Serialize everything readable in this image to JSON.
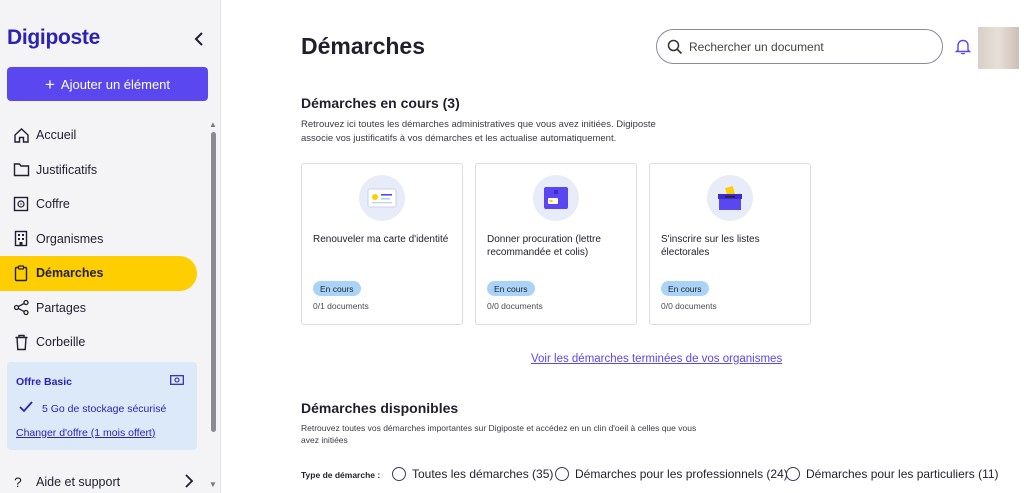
{
  "app": {
    "logo": "Digiposte",
    "add_button": "Ajouter un élément"
  },
  "sidebar": {
    "items": [
      {
        "label": "Accueil",
        "icon": "home-icon"
      },
      {
        "label": "Justificatifs",
        "icon": "folder-icon"
      },
      {
        "label": "Coffre",
        "icon": "safe-icon"
      },
      {
        "label": "Organismes",
        "icon": "building-icon"
      },
      {
        "label": "Démarches",
        "icon": "clipboard-icon",
        "active": true
      },
      {
        "label": "Partages",
        "icon": "share-icon"
      },
      {
        "label": "Corbeille",
        "icon": "trash-icon"
      }
    ],
    "offer": {
      "title": "Offre Basic",
      "storage": "5 Go de stockage sécurisé",
      "change_link": "Changer d'offre (1 mois offert)"
    },
    "help": "Aide et support"
  },
  "header": {
    "title": "Démarches",
    "search_placeholder": "Rechercher un document"
  },
  "in_progress": {
    "title": "Démarches en cours (3)",
    "description_line1": "Retrouvez ici toutes les démarches administratives que vous avez initiées. Digiposte",
    "description_line2": "associe vos justificatifs à vos démarches et les actualise automatiquement.",
    "cards": [
      {
        "title": "Renouveler ma carte d'identité",
        "status": "En cours",
        "docs": "0/1 documents",
        "icon": "id-card-icon"
      },
      {
        "title": "Donner procuration (lettre recommandée et colis)",
        "status": "En cours",
        "docs": "0/0 documents",
        "icon": "mail-box-icon"
      },
      {
        "title": "S'inscrire sur les listes électorales",
        "status": "En cours",
        "docs": "0/0 documents",
        "icon": "ballot-box-icon"
      }
    ],
    "finished_link": "Voir les démarches terminées de vos organismes"
  },
  "available": {
    "title": "Démarches disponibles",
    "description_line1": "Retrouvez toutes vos démarches importantes sur Digiposte et accédez en un clin d'oeil à celles que vous",
    "description_line2": "avez initiées",
    "filter_label": "Type de démarche :",
    "filters": [
      {
        "label": "Toutes les démarches (35)"
      },
      {
        "label": "Démarches pour les professionnels (24)"
      },
      {
        "label": "Démarches pour les particuliers (11)"
      }
    ]
  },
  "colors": {
    "brand": "#2b22b8",
    "accent": "#5a47f0",
    "active_nav": "#ffce00",
    "badge": "#a9d4f7"
  }
}
